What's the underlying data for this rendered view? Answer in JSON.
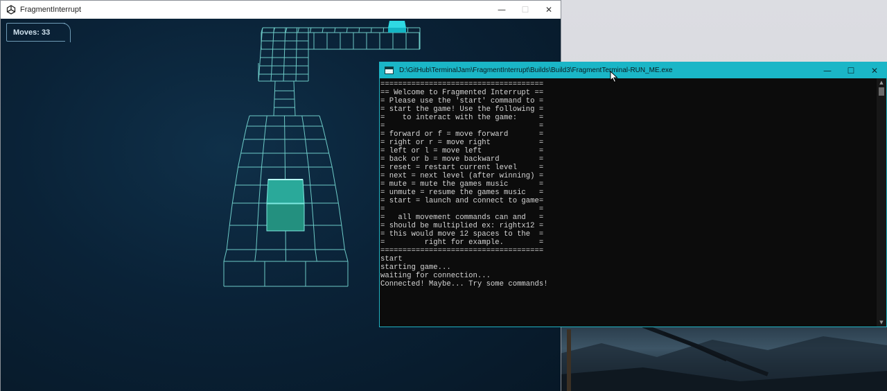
{
  "colors": {
    "grid_line": "#7fe8e0",
    "cube_fill": "#27a892",
    "goal_fill": "#1ad0dd",
    "terminal_titlebar": "#1ab6c7",
    "terminal_bg": "#0c0c0c",
    "viewport_bg": "#0a2237"
  },
  "game_window": {
    "title": "FragmentInterrupt",
    "icon": "unity-icon",
    "controls": {
      "minimize": "—",
      "maximize": "☐",
      "close": "✕"
    },
    "hud": {
      "moves": "Moves: 33"
    }
  },
  "terminal": {
    "title": "D:\\GitHub\\TerminalJam\\FragmentInterrupt\\Builds\\Build3\\FragmentTerminal-RUN_ME.exe",
    "icon": "console-icon",
    "controls": {
      "minimize": "—",
      "maximize": "☐",
      "close": "✕"
    },
    "lines": [
      "=====================================",
      "== Welcome to Fragmented Interrupt ==",
      "= Please use the 'start' command to =",
      "= start the game! Use the following =",
      "=    to interact with the game:     =",
      "=                                   =",
      "= forward or f = move forward       =",
      "= right or r = move right           =",
      "= left or l = move left             =",
      "= back or b = move backward         =",
      "= reset = restart current level     =",
      "= next = next level (after winning) =",
      "= mute = mute the games music       =",
      "= unmute = resume the games music   =",
      "= start = launch and connect to game=",
      "=                                   =",
      "=   all movement commands can and   =",
      "= should be multiplied ex: rightx12 =",
      "= this would move 12 spaces to the  =",
      "=         right for example.        =",
      "=====================================",
      "start",
      "starting game...",
      "waiting for connection...",
      "Connected! Maybe... Try some commands!"
    ]
  }
}
